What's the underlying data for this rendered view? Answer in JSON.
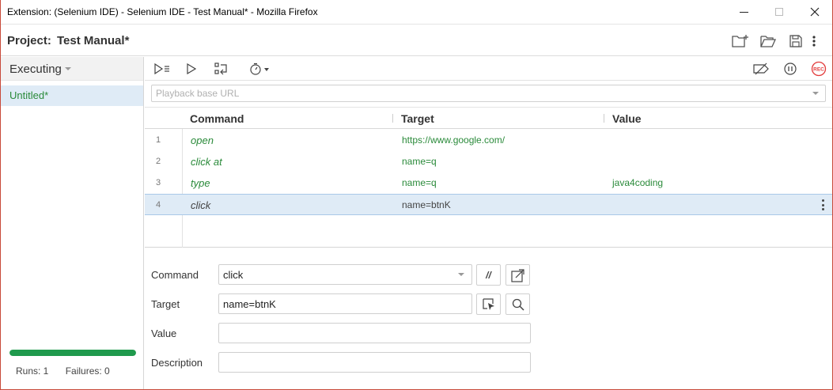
{
  "window": {
    "title": "Extension: (Selenium IDE) - Selenium IDE - Test Manual* - Mozilla Firefox"
  },
  "project": {
    "label": "Project:",
    "name": "Test Manual*",
    "icons": [
      "new-folder-icon",
      "open-folder-icon",
      "save-icon",
      "more-vertical-icon"
    ]
  },
  "sidebar": {
    "selector_label": "Executing",
    "tests": [
      "Untitled*"
    ],
    "progress_fraction": 1.0,
    "runs_label": "Runs: 1",
    "failures_label": "Failures: 0"
  },
  "toolbar": {
    "icons": [
      "run-all-tests-icon",
      "run-current-test-icon",
      "step-over-icon",
      "speed-timer-icon",
      "disable-breakpoints-icon",
      "pause-icon",
      "record-icon"
    ],
    "record_text": "REC"
  },
  "url_bar": {
    "placeholder": "Playback base URL",
    "value": ""
  },
  "table": {
    "headers": [
      "Command",
      "Target",
      "Value"
    ],
    "rows": [
      {
        "num": "1",
        "command": "open",
        "target": "https://www.google.com/",
        "value": ""
      },
      {
        "num": "2",
        "command": "click at",
        "target": "name=q",
        "value": ""
      },
      {
        "num": "3",
        "command": "type",
        "target": "name=q",
        "value": "java4coding"
      },
      {
        "num": "4",
        "command": "click",
        "target": "name=btnK",
        "value": ""
      }
    ],
    "selected_row": 4
  },
  "editor": {
    "command_label": "Command",
    "command_value": "click",
    "comment_button": "//",
    "target_label": "Target",
    "target_value": "name=btnK",
    "value_label": "Value",
    "value_value": "",
    "description_label": "Description",
    "description_value": ""
  },
  "colors": {
    "accent_green": "#2a8a3a",
    "selection_blue": "#dfebf6",
    "progress_green": "#1f9a4d",
    "record_red": "#e23b3b"
  }
}
